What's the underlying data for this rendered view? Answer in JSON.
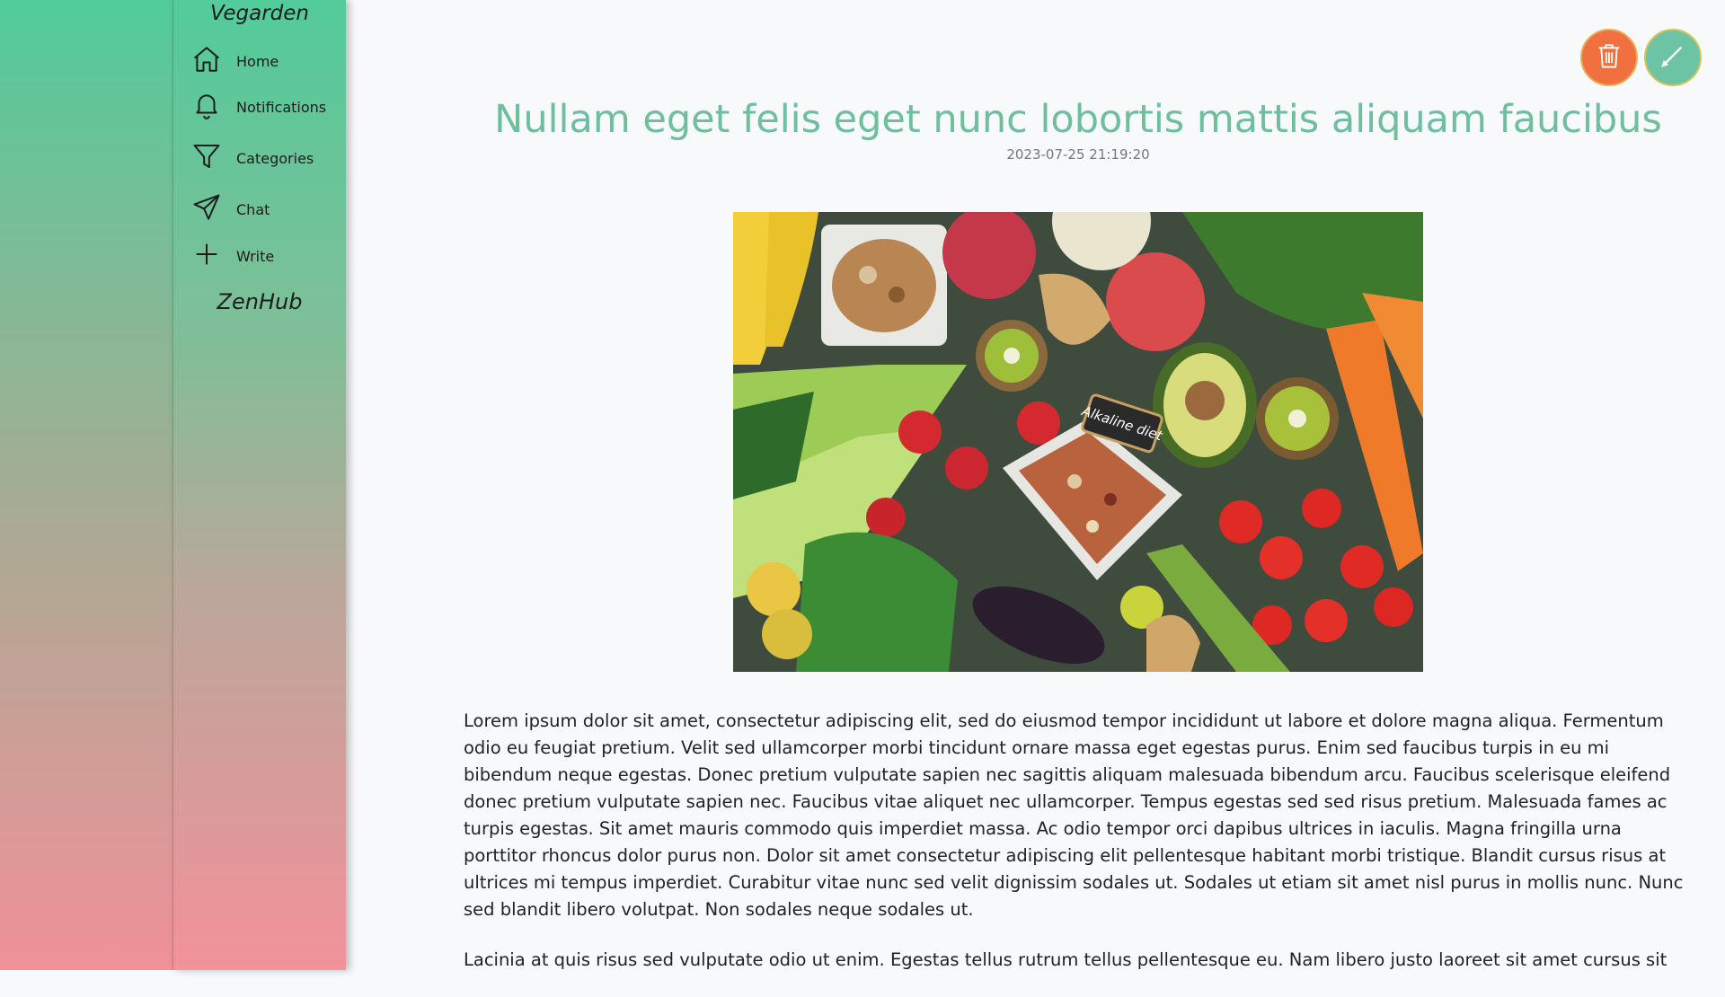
{
  "sidebar": {
    "brand": "Vegarden",
    "items": [
      {
        "label": "Home",
        "icon": "home-icon"
      },
      {
        "label": "Notifications",
        "icon": "bell-icon"
      },
      {
        "label": "Categories",
        "icon": "filter-icon"
      },
      {
        "label": "Chat",
        "icon": "send-icon"
      },
      {
        "label": "Write",
        "icon": "plus-icon"
      }
    ],
    "footer_brand": "ZenHub"
  },
  "actions": {
    "delete_icon": "trash-icon",
    "edit_icon": "pencil-icon",
    "delete_color": "#f0703f",
    "edit_color": "#6cc4a5"
  },
  "post": {
    "title": "Nullam eget felis eget nunc lobortis mattis aliquam faucibus",
    "date": "2023-07-25 21:19:20",
    "image_tag": "Alkaline diet",
    "paragraphs": [
      "Lorem ipsum dolor sit amet, consectetur adipiscing elit, sed do eiusmod tempor incididunt ut labore et dolore magna aliqua. Fermentum odio eu feugiat pretium. Velit sed ullamcorper morbi tincidunt ornare massa eget egestas purus. Enim sed faucibus turpis in eu mi bibendum neque egestas. Donec pretium vulputate sapien nec sagittis aliquam malesuada bibendum arcu. Faucibus scelerisque eleifend donec pretium vulputate sapien nec. Faucibus vitae aliquet nec ullamcorper. Tempus egestas sed sed risus pretium. Malesuada fames ac turpis egestas. Sit amet mauris commodo quis imperdiet massa. Ac odio tempor orci dapibus ultrices in iaculis. Magna fringilla urna porttitor rhoncus dolor purus non. Dolor sit amet consectetur adipiscing elit pellentesque habitant morbi tristique. Blandit cursus risus at ultrices mi tempus imperdiet. Curabitur vitae nunc sed velit dignissim sodales ut. Sodales ut etiam sit amet nisl purus in mollis nunc. Nunc sed blandit libero volutpat. Non sodales neque sodales ut.",
      "Lacinia at quis risus sed vulputate odio ut enim. Egestas tellus rutrum tellus pellentesque eu. Nam libero justo laoreet sit amet cursus sit"
    ]
  },
  "colors": {
    "accent": "#6dbf9d",
    "gradient_top": "#53cb9a",
    "gradient_bottom": "#f2929a"
  }
}
